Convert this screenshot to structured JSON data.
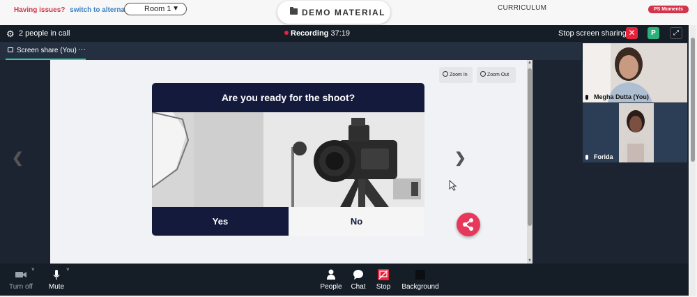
{
  "page": {
    "issues_text": "Having issues?",
    "switch_link": "switch to alternate room",
    "room_selector": "Room 1",
    "demo_material": "DEMO MATERIAL",
    "curriculum": "CURRICULUM",
    "moments_badge": "PS Moments"
  },
  "call": {
    "participants_count": "2 people in call",
    "recording_label": "Recording",
    "recording_time": "37:19",
    "stop_share": "Stop screen sharing",
    "p_badge": "P",
    "tab_label": "Screen share (You)",
    "tab_more": "···"
  },
  "share": {
    "zoom_in": "Zoom In",
    "zoom_out": "Zoom Out",
    "question": "Are you ready for the shoot?",
    "option_yes": "Yes",
    "option_no": "No",
    "prev": "❮",
    "next": "❯"
  },
  "participants": [
    {
      "name": "Megha Dutta (You)"
    },
    {
      "name": "Forida"
    }
  ],
  "toolbar": {
    "turn_off": "Turn off",
    "mute": "Mute",
    "people": "People",
    "chat": "Chat",
    "stop": "Stop",
    "background": "Background"
  },
  "colors": {
    "accent": "#35c9a4",
    "danger": "#e5243b",
    "brand_navy": "#141a3c",
    "share_fab": "#e5385a"
  }
}
